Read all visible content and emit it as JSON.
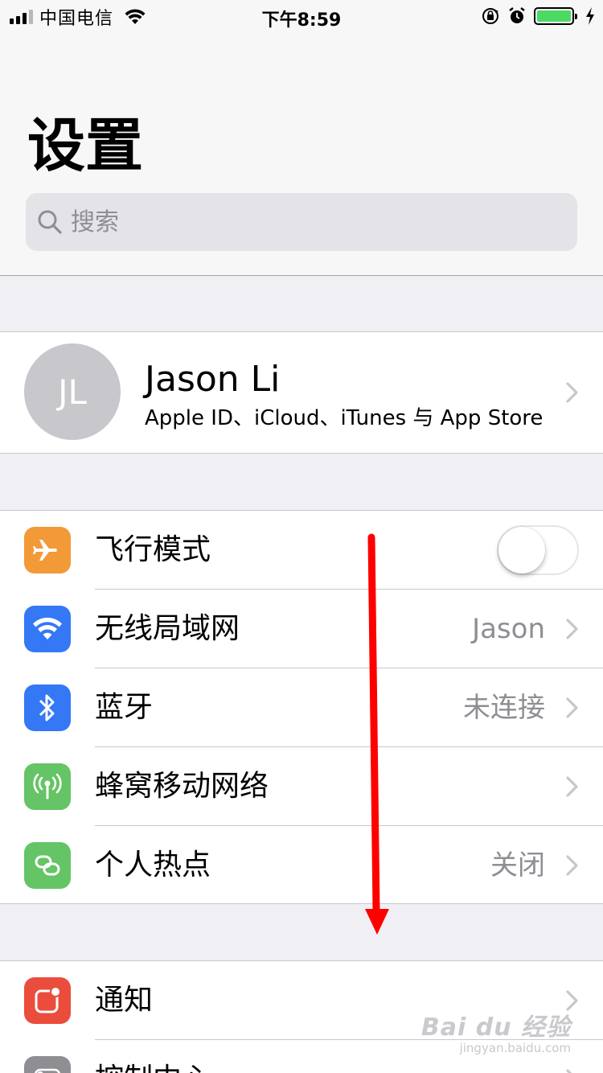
{
  "status_bar": {
    "carrier": "中国电信",
    "time": "下午8:59",
    "signal_bars": 4,
    "signal_bars_filled": 3,
    "battery_level": 1.0,
    "battery_color": "#4cd964",
    "icons": [
      "signal-icon",
      "wifi-icon",
      "rotation-lock-icon",
      "alarm-icon",
      "battery-icon",
      "charging-bolt-icon"
    ]
  },
  "header": {
    "title": "设置"
  },
  "search": {
    "placeholder": "搜索"
  },
  "profile": {
    "initials": "JL",
    "name": "Jason Li",
    "subtitle": "Apple ID、iCloud、iTunes 与 App Store"
  },
  "settings_group_1": {
    "items": [
      {
        "label": "飞行模式",
        "icon": "airplane-icon",
        "color": "#f19a37",
        "toggle": "off"
      },
      {
        "label": "无线局域网",
        "icon": "wifi-icon",
        "color": "#3478f6",
        "value": "Jason"
      },
      {
        "label": "蓝牙",
        "icon": "bluetooth-icon",
        "color": "#3478f6",
        "value": "未连接"
      },
      {
        "label": "蜂窝移动网络",
        "icon": "cellular-antenna-icon",
        "color": "#65c466",
        "value": ""
      },
      {
        "label": "个人热点",
        "icon": "hotspot-link-icon",
        "color": "#65c466",
        "value": "关闭"
      }
    ]
  },
  "settings_group_2": {
    "items": [
      {
        "label": "通知",
        "icon": "notifications-icon",
        "color": "#eb4d3d"
      },
      {
        "label": "控制中心",
        "icon": "control-center-icon",
        "color": "#8e8e93"
      }
    ]
  },
  "annotation": {
    "arrow_color": "#ff0000",
    "direction": "down"
  },
  "watermark": {
    "main": "Bai du 经验",
    "sub": "jingyan.baidu.com"
  }
}
